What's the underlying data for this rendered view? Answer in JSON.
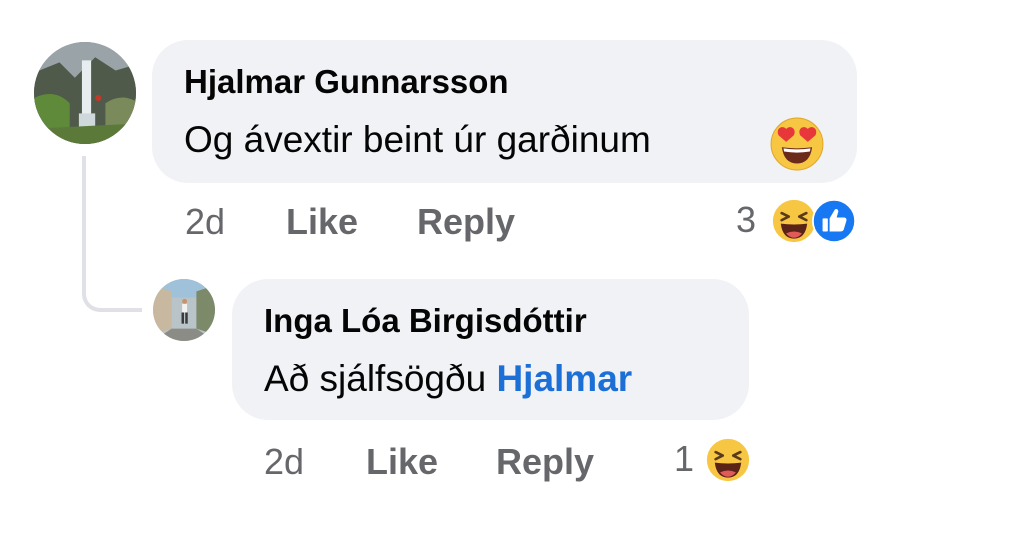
{
  "comments": [
    {
      "author": "Hjalmar Gunnarsson",
      "text": "Og ávextir beint úr garðinum",
      "text_emoji": "heart-eyes-emoji",
      "time": "2d",
      "like_label": "Like",
      "reply_label": "Reply",
      "reaction_count": "3",
      "reactions": [
        "laugh-reaction",
        "like-reaction"
      ]
    },
    {
      "author": "Inga Lóa Birgisdóttir",
      "text": "Að sjálfsögðu",
      "mention": "Hjalmar",
      "time": "2d",
      "like_label": "Like",
      "reply_label": "Reply",
      "reaction_count": "1",
      "reactions": [
        "laugh-reaction"
      ]
    }
  ],
  "colors": {
    "bubble": "#f0f2f5",
    "secondary_text": "#65676b",
    "mention": "#1b6fd6",
    "thread_line": "#dfe1e6",
    "like_blue": "#1877f2",
    "emoji_yellow": "#f7c744"
  }
}
